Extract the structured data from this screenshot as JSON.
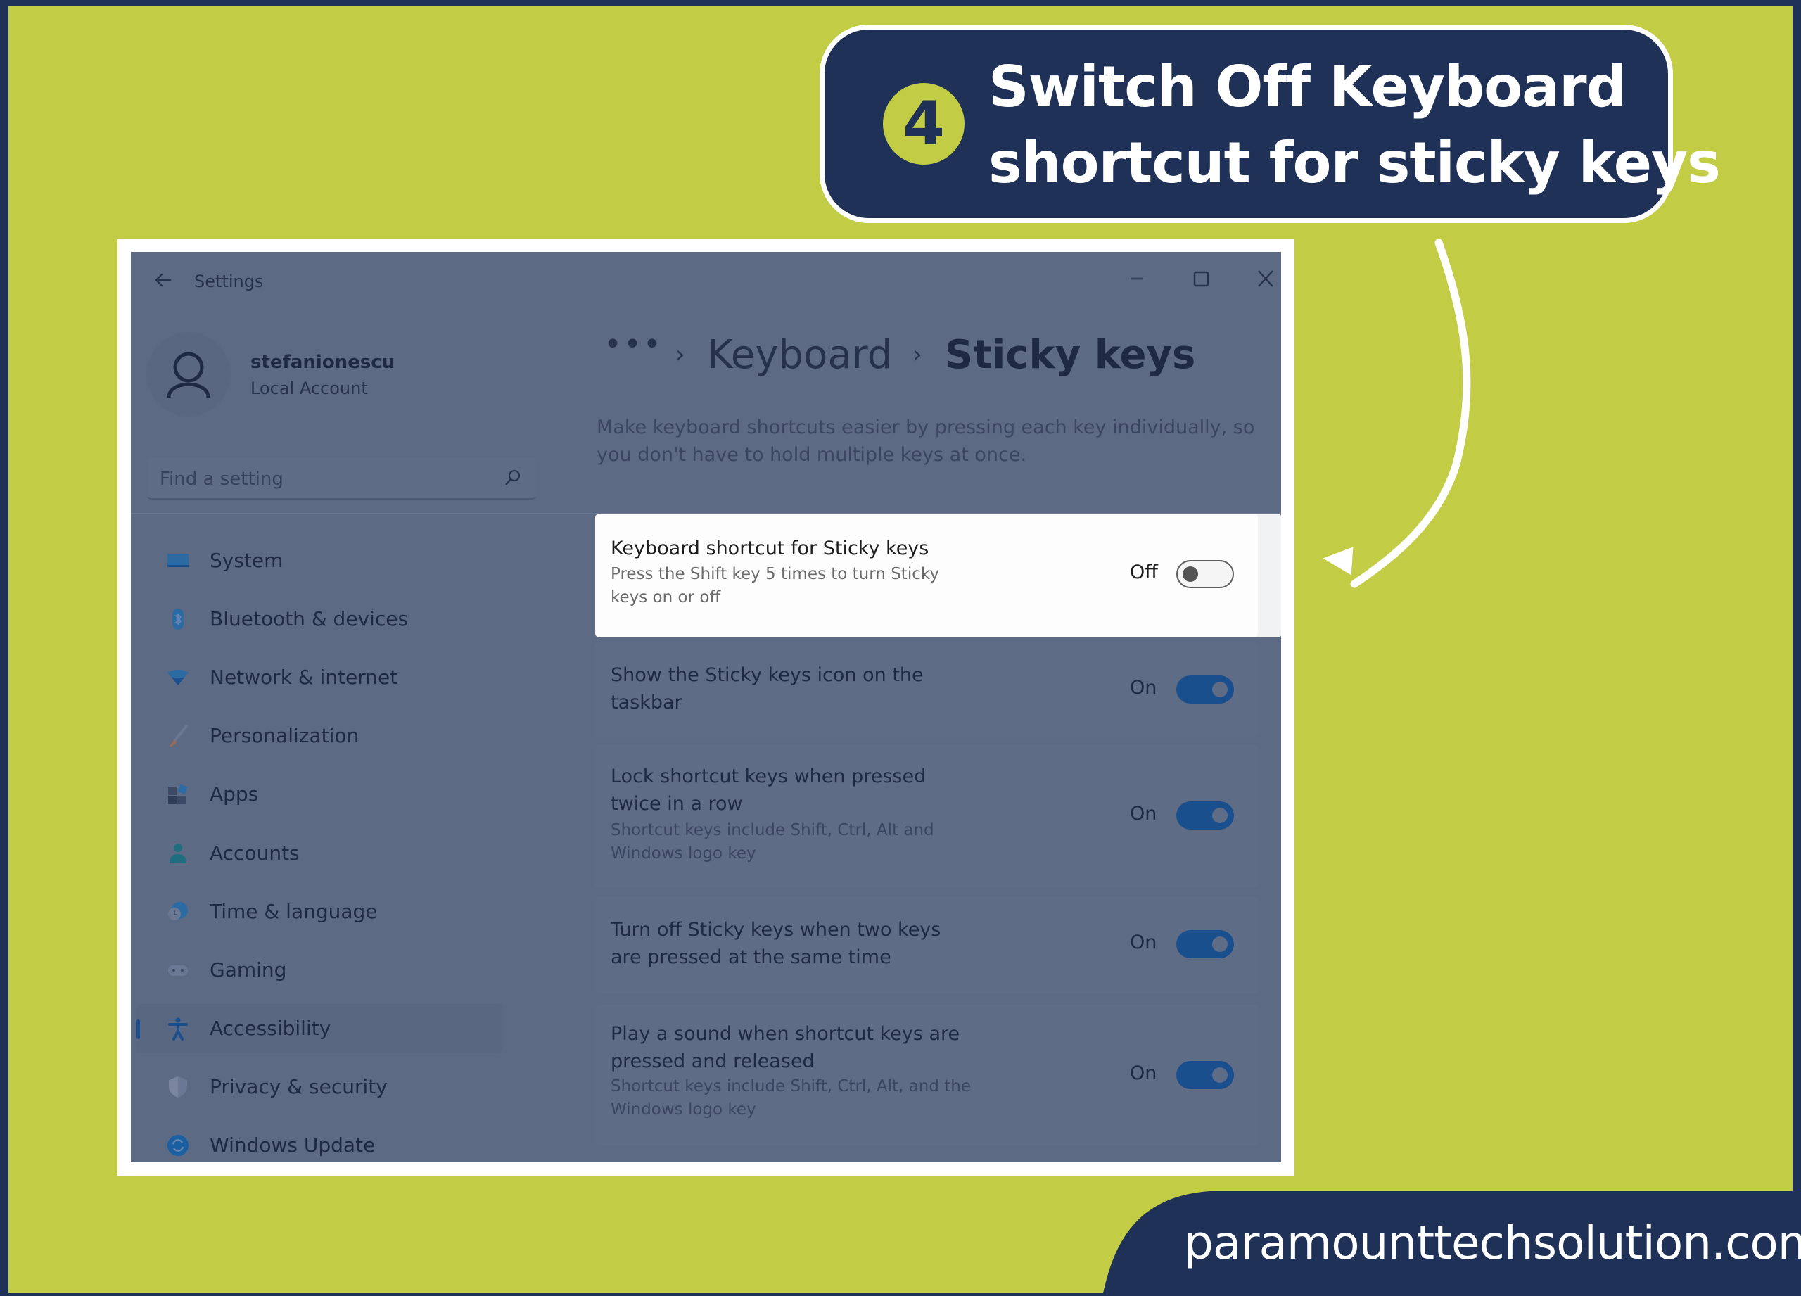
{
  "callout": {
    "step_number": "4",
    "line1": "Switch Off Keyboard",
    "line2": "shortcut for sticky keys"
  },
  "colors": {
    "brand_navy": "#1f3157",
    "brand_green": "#c2cd45",
    "toggle_on": "#1a4f8e",
    "window_dim": "#5d6a84"
  },
  "window": {
    "title": "Settings",
    "icons": {
      "back": "arrow-left-icon",
      "minimize": "minimize-icon",
      "maximize": "maximize-icon",
      "close": "close-icon"
    }
  },
  "account": {
    "username": "stefanionescu",
    "type": "Local Account"
  },
  "search": {
    "placeholder": "Find a setting"
  },
  "sidebar": {
    "items": [
      {
        "label": "System",
        "icon": "monitor-icon",
        "selected": false
      },
      {
        "label": "Bluetooth & devices",
        "icon": "bluetooth-icon",
        "selected": false
      },
      {
        "label": "Network & internet",
        "icon": "wifi-icon",
        "selected": false
      },
      {
        "label": "Personalization",
        "icon": "brush-icon",
        "selected": false
      },
      {
        "label": "Apps",
        "icon": "apps-icon",
        "selected": false
      },
      {
        "label": "Accounts",
        "icon": "person-icon",
        "selected": false
      },
      {
        "label": "Time & language",
        "icon": "globe-clock-icon",
        "selected": false
      },
      {
        "label": "Gaming",
        "icon": "gamepad-icon",
        "selected": false
      },
      {
        "label": "Accessibility",
        "icon": "accessibility-icon",
        "selected": true
      },
      {
        "label": "Privacy & security",
        "icon": "shield-icon",
        "selected": false
      },
      {
        "label": "Windows Update",
        "icon": "update-icon",
        "selected": false
      }
    ]
  },
  "breadcrumb": {
    "overflow": "•••",
    "separator": "›",
    "parent": "Keyboard",
    "current": "Sticky keys"
  },
  "page": {
    "description": "Make keyboard shortcuts easier by pressing each key individually, so you don't have to hold multiple keys at once."
  },
  "settings": [
    {
      "title": "Keyboard shortcut for Sticky keys",
      "subtitle": "Press the Shift key 5 times to turn Sticky keys on or off",
      "state_label": "Off",
      "on": false,
      "highlighted": true
    },
    {
      "title": "Show the Sticky keys icon on the taskbar",
      "subtitle": "",
      "state_label": "On",
      "on": true,
      "highlighted": false
    },
    {
      "title": "Lock shortcut keys when pressed twice in a row",
      "subtitle": "Shortcut keys include Shift, Ctrl, Alt and Windows logo key",
      "state_label": "On",
      "on": true,
      "highlighted": false
    },
    {
      "title": "Turn off Sticky keys when two keys are pressed at the same time",
      "subtitle": "",
      "state_label": "On",
      "on": true,
      "highlighted": false
    },
    {
      "title": "Play a sound when shortcut keys are pressed and released",
      "subtitle": "Shortcut keys include Shift, Ctrl, Alt, and the Windows logo key",
      "state_label": "On",
      "on": true,
      "highlighted": false
    }
  ],
  "footer": {
    "website": "paramounttechsolution.com"
  }
}
